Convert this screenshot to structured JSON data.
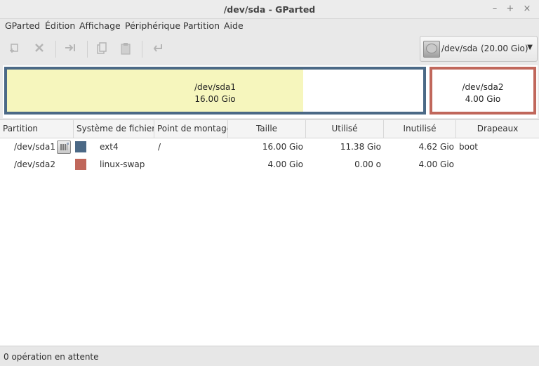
{
  "window": {
    "title": "/dev/sda - GParted"
  },
  "window_controls": {
    "minimize": "–",
    "maximize": "+",
    "close": "×"
  },
  "menu": [
    "GParted",
    "Édition",
    "Affichage",
    "Périphérique",
    "Partition",
    "Aide"
  ],
  "toolbar": {
    "new_icon": "new-partition-icon",
    "delete_icon": "delete-icon",
    "resize_icon": "resize-move-icon",
    "copy_icon": "copy-icon",
    "paste_icon": "paste-icon",
    "undo_icon": "undo-icon"
  },
  "device": {
    "name": "/dev/sda",
    "size": "(20.00 Gio)"
  },
  "diskmap": {
    "sda1": {
      "name": "/dev/sda1",
      "size": "16.00 Gio",
      "used_fraction": 0.711,
      "border_color": "#4b6986",
      "used_color": "#f6f6bd"
    },
    "sda2": {
      "name": "/dev/sda2",
      "size": "4.00 Gio",
      "border_color": "#c0675b"
    }
  },
  "table": {
    "headers": [
      "Partition",
      "Système de fichiers",
      "Point de montage",
      "Taille",
      "Utilisé",
      "Inutilisé",
      "Drapeaux"
    ],
    "rows": [
      {
        "partition": "/dev/sda1",
        "color": "#4b6986",
        "filesystem": "ext4",
        "mountpoint": "/",
        "size": "16.00 Gio",
        "used": "11.38 Gio",
        "unused": "4.62 Gio",
        "flags": "boot"
      },
      {
        "partition": "/dev/sda2",
        "color": "#c0675b",
        "filesystem": "linux-swap",
        "mountpoint": "",
        "size": "4.00 Gio",
        "used": "0.00 o",
        "unused": "4.00 Gio",
        "flags": ""
      }
    ]
  },
  "status": {
    "text": "0 opération en attente"
  }
}
